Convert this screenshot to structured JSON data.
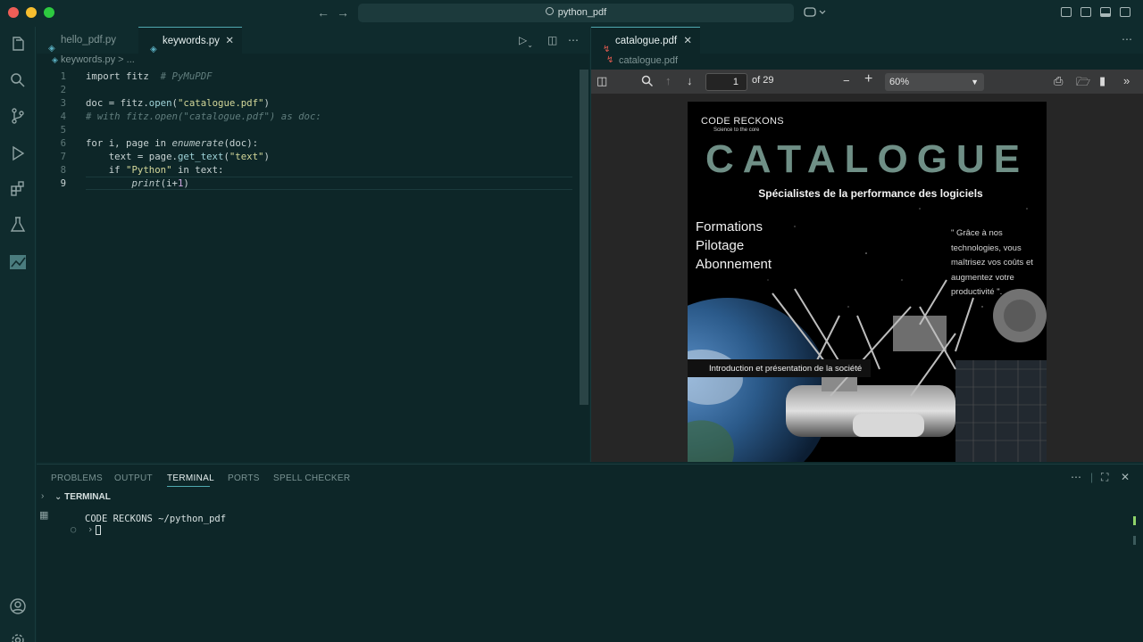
{
  "titlebar": {
    "search_text": "python_pdf"
  },
  "editor": {
    "tabs": [
      {
        "label": "hello_pdf.py",
        "active": false
      },
      {
        "label": "keywords.py",
        "active": true
      }
    ],
    "breadcrumb": "keywords.py > ...",
    "lines": [
      {
        "num": "1",
        "segments": [
          [
            "kw",
            "import fitz  "
          ],
          [
            "cmt",
            "# PyMuPDF"
          ]
        ]
      },
      {
        "num": "2",
        "segments": []
      },
      {
        "num": "3",
        "segments": [
          [
            "kw",
            "doc = fitz."
          ],
          [
            "fn",
            "open"
          ],
          [
            "kw",
            "("
          ],
          [
            "str",
            "\"catalogue.pdf\""
          ],
          [
            "kw",
            ")"
          ]
        ]
      },
      {
        "num": "4",
        "segments": [
          [
            "cmt",
            "# with fitz.open(\"catalogue.pdf\") as doc:"
          ]
        ]
      },
      {
        "num": "5",
        "segments": []
      },
      {
        "num": "6",
        "segments": [
          [
            "kw",
            "for i, page in "
          ],
          [
            "it",
            "enumerate"
          ],
          [
            "kw",
            "(doc):"
          ]
        ]
      },
      {
        "num": "7",
        "segments": [
          [
            "kw",
            "    text = page."
          ],
          [
            "fn",
            "get_text"
          ],
          [
            "kw",
            "("
          ],
          [
            "str",
            "\"text\""
          ],
          [
            "kw",
            ")"
          ]
        ]
      },
      {
        "num": "8",
        "segments": [
          [
            "kw",
            "    if "
          ],
          [
            "str",
            "\"Python\""
          ],
          [
            "kw",
            " in text:"
          ]
        ]
      },
      {
        "num": "9",
        "segments": [
          [
            "kw",
            "        "
          ],
          [
            "it",
            "print"
          ],
          [
            "kw",
            "(i+"
          ],
          [
            "num",
            "1"
          ],
          [
            "kw",
            ")"
          ]
        ]
      }
    ]
  },
  "pdf": {
    "tab_label": "catalogue.pdf",
    "breadcrumb": "catalogue.pdf",
    "page_number": "1",
    "page_of": "of 29",
    "zoom": "60%",
    "cover": {
      "brand": "CODE RECKONS",
      "tagline": "Science to the core",
      "title": "CATALOGUE",
      "subtitle": "Spécialistes de la performance des logiciels",
      "menu": [
        "Formations",
        "Pilotage",
        "Abonnement"
      ],
      "quote": "\" Grâce à nos technologies, vous maîtrisez vos coûts et augmentez votre productivité \".",
      "intro": "Introduction et présentation de la société"
    }
  },
  "panel": {
    "tabs": [
      "PROBLEMS",
      "OUTPUT",
      "TERMINAL",
      "PORTS",
      "SPELL CHECKER"
    ],
    "active_tab": "TERMINAL",
    "terminal_header": "TERMINAL",
    "prompt_line": "CODE RECKONS ~/python_pdf",
    "prompt_symbol": "›"
  },
  "colors": {
    "accent": "#4fa9b0",
    "background": "#0d2628",
    "string": "#d4d89a",
    "comment": "#607d7d"
  }
}
